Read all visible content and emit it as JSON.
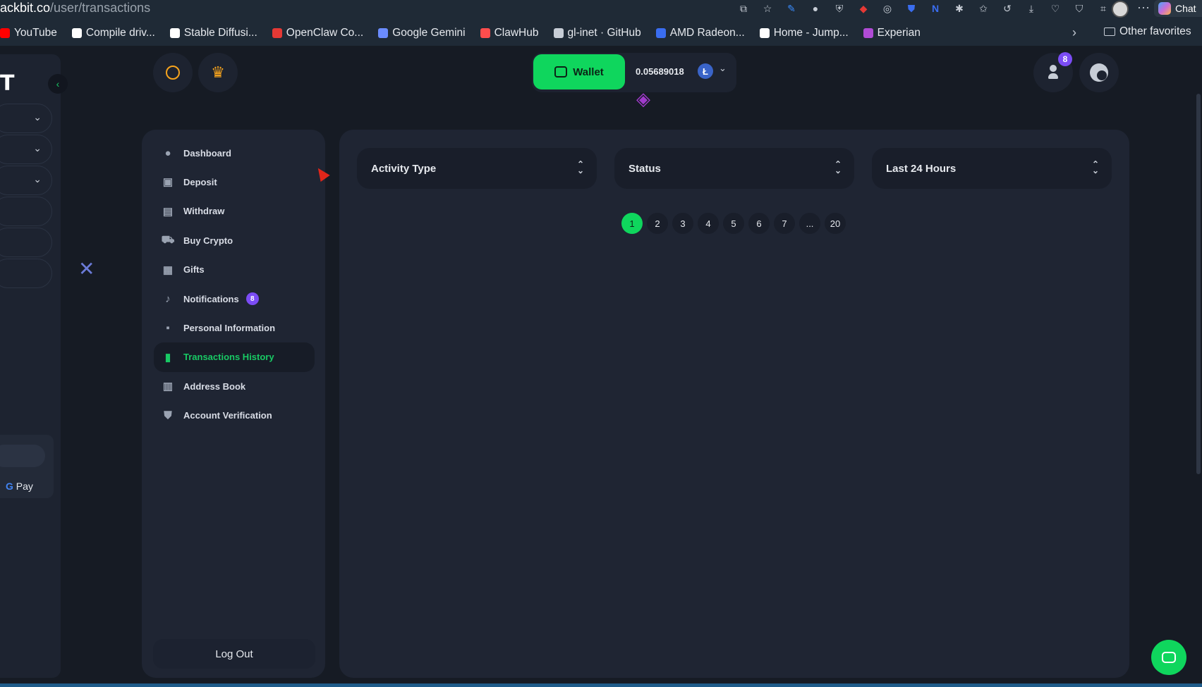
{
  "browser": {
    "url_host": "ackbit.co",
    "url_path": "/user/transactions",
    "copilot_label": "Chat",
    "bookmarks": [
      {
        "label": "YouTube",
        "color": "#ff0000"
      },
      {
        "label": "Compile driv...",
        "color": "#ffffff"
      },
      {
        "label": "Stable Diffusi...",
        "color": "#ffffff"
      },
      {
        "label": "OpenClaw Co...",
        "color": "#e53935"
      },
      {
        "label": "Google Gemini",
        "color": "#6b8cff"
      },
      {
        "label": "ClawHub",
        "color": "#ff4d4d"
      },
      {
        "label": "gl-inet · GitHub",
        "color": "#c7cdd6"
      },
      {
        "label": "AMD Radeon...",
        "color": "#3a6df0"
      },
      {
        "label": "Home - Jump...",
        "color": "#ffffff"
      },
      {
        "label": "Experian",
        "color": "#b04bd6"
      }
    ],
    "other_favorites": "Other favorites"
  },
  "header": {
    "wallet_label": "Wallet",
    "balance": "0.05689018",
    "currency_icon": "litecoin-icon",
    "notification_count": "8"
  },
  "rail": {
    "logo_letter": "T",
    "pay_label": "Pay",
    "pay_g": "G"
  },
  "menu": {
    "items": [
      {
        "label": "Dashboard",
        "icon": "user-icon"
      },
      {
        "label": "Deposit",
        "icon": "deposit-icon"
      },
      {
        "label": "Withdraw",
        "icon": "withdraw-icon"
      },
      {
        "label": "Buy Crypto",
        "icon": "cart-icon"
      },
      {
        "label": "Gifts",
        "icon": "gift-icon"
      },
      {
        "label": "Notifications",
        "icon": "bell-icon",
        "badge": "8"
      },
      {
        "label": "Personal Information",
        "icon": "id-card-icon"
      },
      {
        "label": "Transactions History",
        "icon": "chart-icon",
        "active": true
      },
      {
        "label": "Address Book",
        "icon": "book-icon"
      },
      {
        "label": "Account Verification",
        "icon": "shield-check-icon"
      }
    ],
    "logout": "Log Out"
  },
  "filters": {
    "activity_type": "Activity Type",
    "status": "Status",
    "period": "Last 24 Hours"
  },
  "pagination": {
    "pages": [
      "1",
      "2",
      "3",
      "4",
      "5",
      "6",
      "7",
      "...",
      "20"
    ],
    "current": "1"
  },
  "colors": {
    "accent": "#0fd65d",
    "badge": "#7b4cf5"
  }
}
